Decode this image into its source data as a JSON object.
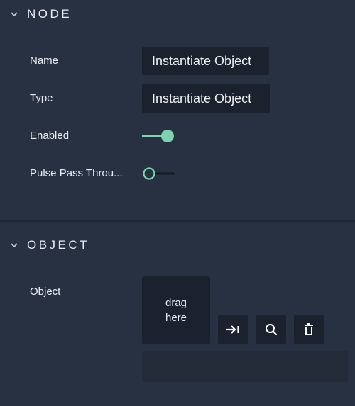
{
  "sections": {
    "node": {
      "title": "NODE",
      "fields": {
        "name": {
          "label": "Name",
          "value": "Instantiate Object"
        },
        "type": {
          "label": "Type",
          "value": "Instantiate Object"
        },
        "enabled": {
          "label": "Enabled",
          "on": true
        },
        "pulse": {
          "label": "Pulse Pass Throu...",
          "on": false
        }
      }
    },
    "object": {
      "title": "OBJECT",
      "field_label": "Object",
      "drop_text": "drag\nhere",
      "path_value": ""
    }
  },
  "colors": {
    "accent": "#7dd3b0",
    "background": "#283142",
    "field_bg": "#1b212d"
  },
  "icons": [
    "chevron-down-icon",
    "jump-to-icon",
    "search-icon",
    "trash-icon"
  ]
}
